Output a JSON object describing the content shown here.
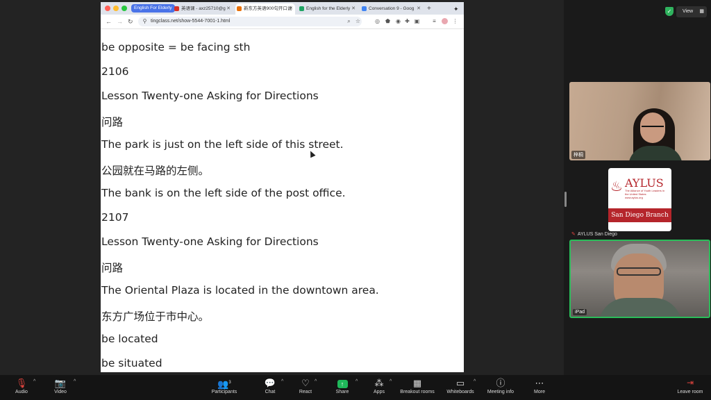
{
  "browser": {
    "tab_group": "English For Elderly",
    "tabs": [
      {
        "label": "英语课 - axz25710@g"
      },
      {
        "label": "新东方英语900句开口说"
      },
      {
        "label": "English for the Elderly"
      },
      {
        "label": "Conversation 9 - Goog"
      }
    ],
    "url": "tingclass.net/show-5544-7001-1.html"
  },
  "content": {
    "lines": [
      "be opposite = be facing sth",
      "2106",
      "Lesson Twenty-one Asking for Directions",
      "问路",
      "The park is just on the left side of this street.",
      "公园就在马路的左侧。",
      "The bank is on the left side of the post office.",
      "2107",
      "Lesson Twenty-one Asking for Directions",
      "问路",
      "The Oriental Plaza is located in the downtown area.",
      "东方广场位于市中心。",
      "be located",
      "be situated"
    ]
  },
  "panel": {
    "view_label": "View",
    "participant1_name": "梓桐",
    "aylus": {
      "title": "AYLUS",
      "subtitle": "The Alliance of Youth Leaders in the United States",
      "url": "www.aylus.org",
      "branch": "San Diego Branch"
    },
    "participant2_name": "AYLUS San Diego",
    "participant3_name": "iPad"
  },
  "toolbar": {
    "audio": "Audio",
    "video": "Video",
    "participants": "Participants",
    "participants_count": "3",
    "chat": "Chat",
    "react": "React",
    "share": "Share",
    "apps": "Apps",
    "breakout": "Breakout rooms",
    "whiteboards": "Whiteboards",
    "meeting_info": "Meeting info",
    "more": "More",
    "leave": "Leave room"
  },
  "colors": {
    "share_green": "#1fb85a",
    "aylus_red": "#b5252b",
    "active_speaker_border": "#2bbd5a",
    "mute_red": "#e0443e"
  }
}
